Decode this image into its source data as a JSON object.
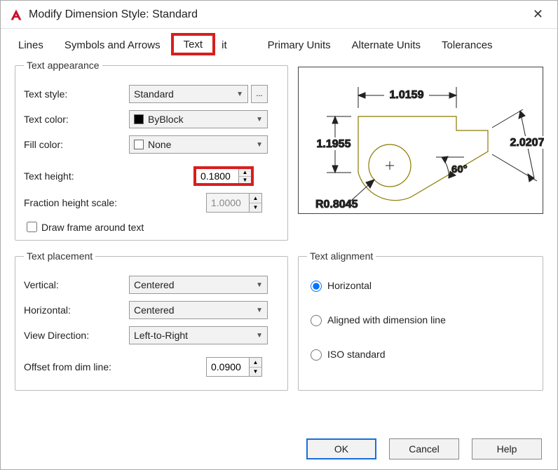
{
  "window": {
    "title": "Modify Dimension Style: Standard"
  },
  "tabs": {
    "lines": "Lines",
    "symbols": "Symbols and Arrows",
    "text": "Text",
    "fit": "it",
    "primary": "Primary Units",
    "alternate": "Alternate Units",
    "tolerances": "Tolerances"
  },
  "appearance": {
    "legend": "Text appearance",
    "style_label": "Text style:",
    "style_value": "Standard",
    "color_label": "Text color:",
    "color_value": "ByBlock",
    "fill_label": "Fill color:",
    "fill_value": "None",
    "height_label": "Text height:",
    "height_value": "0.1800",
    "fraction_label": "Fraction height scale:",
    "fraction_value": "1.0000",
    "draw_frame_label": "Draw frame around text"
  },
  "placement": {
    "legend": "Text placement",
    "vertical_label": "Vertical:",
    "vertical_value": "Centered",
    "horizontal_label": "Horizontal:",
    "horizontal_value": "Centered",
    "viewdir_label": "View Direction:",
    "viewdir_value": "Left-to-Right",
    "offset_label": "Offset from dim line:",
    "offset_value": "0.0900"
  },
  "alignment": {
    "legend": "Text alignment",
    "horizontal": "Horizontal",
    "aligned": "Aligned with dimension line",
    "iso": "ISO standard"
  },
  "preview": {
    "dim1": "1.0159",
    "dim2": "1.1955",
    "dim3": "2.0207",
    "angle": "60°",
    "radius": "R0.8045"
  },
  "buttons": {
    "ok": "OK",
    "cancel": "Cancel",
    "help": "Help"
  },
  "glyphs": {
    "ellipsis": "...",
    "plus": "+"
  }
}
